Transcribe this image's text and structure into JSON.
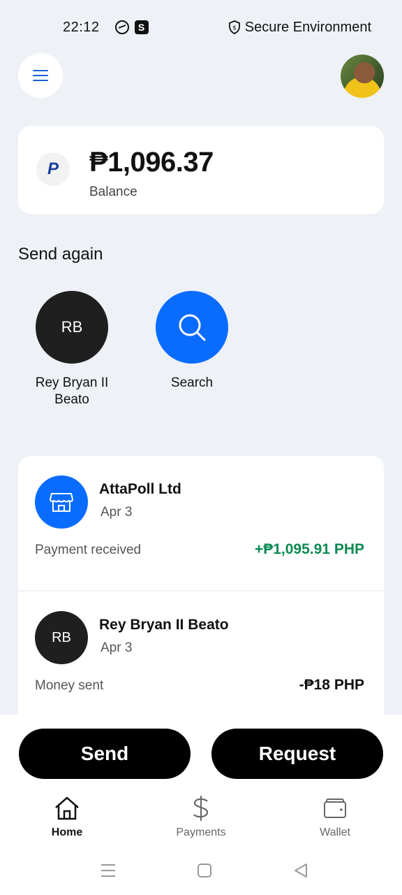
{
  "status_bar": {
    "time": "22:12",
    "messenger_icon": "messenger-icon",
    "s_icon_label": "S",
    "secure_text": "Secure Environment"
  },
  "header": {
    "menu_icon": "hamburger-menu-icon",
    "avatar": "profile-avatar"
  },
  "balance": {
    "logo_letter": "P",
    "amount": "₱1,096.37",
    "label": "Balance"
  },
  "send_again": {
    "title": "Send again",
    "contacts": [
      {
        "initials": "RB",
        "name": "Rey Bryan II Beato",
        "color": "#1f1f1f"
      },
      {
        "initials": "",
        "name": "Search",
        "icon": "search-icon",
        "color": "#0a6cff"
      }
    ]
  },
  "transactions": [
    {
      "name": "AttaPoll Ltd",
      "date": "Apr 3",
      "description": "Payment received",
      "amount": "+₱1,095.91 PHP",
      "amount_color": "#0b8a52",
      "icon": "store-icon",
      "icon_color": "#0a6cff"
    },
    {
      "name": "Rey Bryan II Beato",
      "initials": "RB",
      "date": "Apr 3",
      "description": "Money sent",
      "amount": "-₱18 PHP",
      "amount_color": "#111111",
      "icon_color": "#1f1f1f"
    }
  ],
  "actions": {
    "send_label": "Send",
    "request_label": "Request"
  },
  "bottom_nav": [
    {
      "label": "Home",
      "icon": "home-icon",
      "active": true
    },
    {
      "label": "Payments",
      "icon": "dollar-icon",
      "active": false
    },
    {
      "label": "Wallet",
      "icon": "wallet-icon",
      "active": false
    }
  ],
  "colors": {
    "background": "#eef1f6",
    "accent": "#0a6cff",
    "positive": "#0b8a52"
  }
}
